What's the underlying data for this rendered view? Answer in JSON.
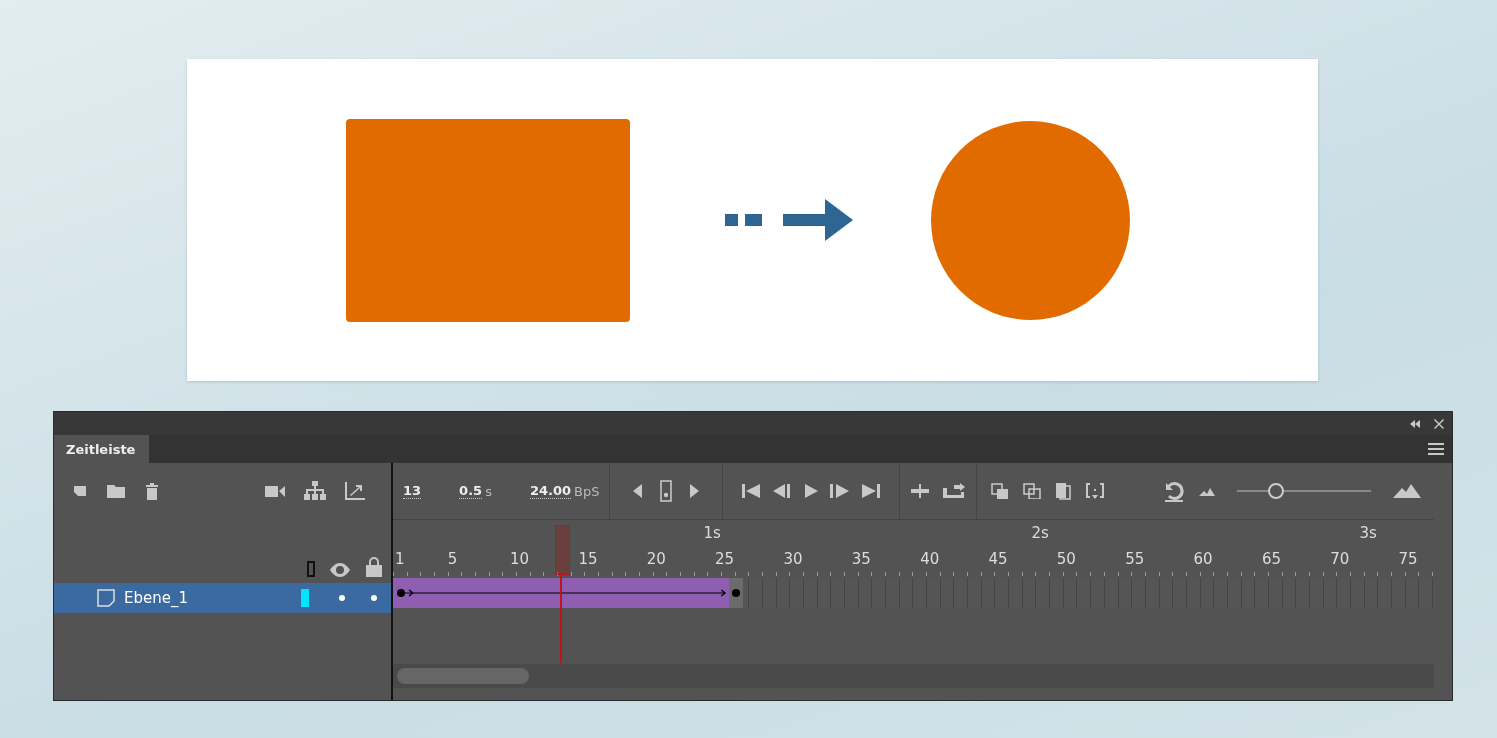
{
  "panel": {
    "tab": {
      "label": "Zeitleiste",
      "selected": true
    }
  },
  "status": {
    "frame": "13",
    "time": "0.5",
    "time_unit": "s",
    "rate": "24.00",
    "rate_unit": "BpS"
  },
  "zoom_slider": {
    "level": 0.29
  },
  "ruler": {
    "seconds": [
      "1s",
      "2s",
      "3s"
    ],
    "frames": [
      "1",
      "5",
      "10",
      "15",
      "20",
      "25",
      "30",
      "35",
      "40",
      "45",
      "50",
      "55",
      "60",
      "65",
      "70",
      "75"
    ]
  },
  "playhead": {
    "level": 0.161
  },
  "layers": [
    {
      "name": "Ebene_1",
      "selected": true,
      "color": "#00e5ff",
      "tween": {
        "level": 0.323
      }
    }
  ]
}
